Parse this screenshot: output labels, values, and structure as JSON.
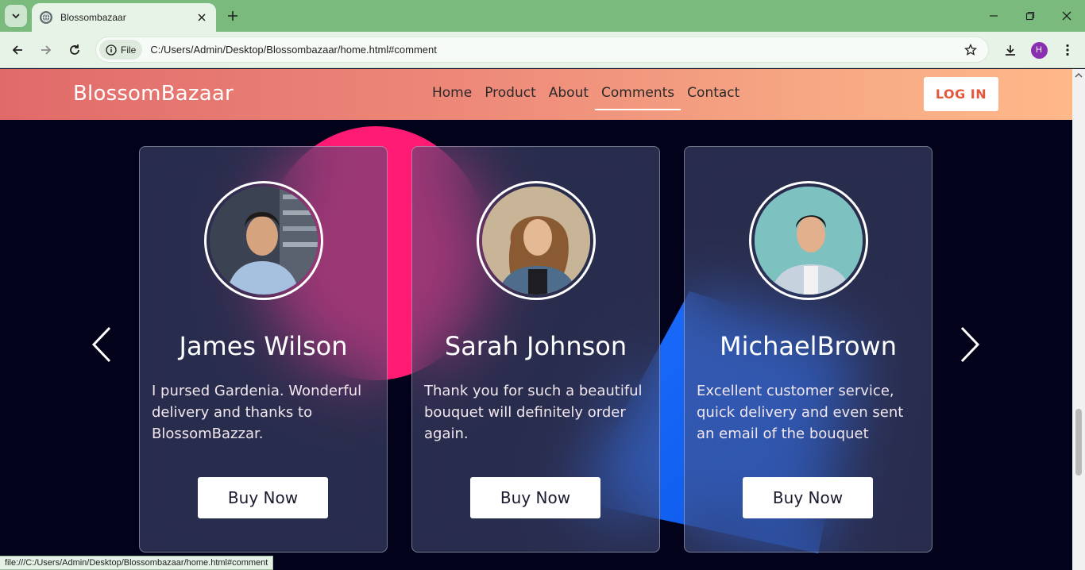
{
  "browser": {
    "tab_title": "Blossombazaar",
    "site_info_label": "File",
    "url": "C:/Users/Admin/Desktop/Blossombazaar/home.html#comment",
    "profile_initial": "H",
    "status_url": "file:///C:/Users/Admin/Desktop/Blossombazaar/home.html#comment",
    "colors": {
      "tabbar": "#7bba7d",
      "toolbar": "#e8f3e8",
      "profile": "#8a2fb0"
    }
  },
  "site": {
    "brand": "BlossomBazaar",
    "nav": [
      {
        "label": "Home",
        "active": false
      },
      {
        "label": "Product",
        "active": false
      },
      {
        "label": "About",
        "active": false
      },
      {
        "label": "Comments",
        "active": true
      },
      {
        "label": "Contact",
        "active": false
      }
    ],
    "login_label": "LOG IN",
    "colors": {
      "header_start": "#e06a6a",
      "header_end": "#ffb889",
      "login_text": "#e4573a",
      "background": "#02031a"
    }
  },
  "testimonials": {
    "prev_icon": "chevron-left-icon",
    "next_icon": "chevron-right-icon",
    "cards": [
      {
        "name": "James Wilson",
        "comment": "I pursed Gardenia. Wonderful delivery and thanks to BlossomBazzar.",
        "button": "Buy Now"
      },
      {
        "name": "Sarah Johnson",
        "comment": "Thank you for such a beautiful bouquet will definitely order again.",
        "button": "Buy Now"
      },
      {
        "name": "MichaelBrown",
        "comment": "Excellent customer service, quick delivery and even sent an email of the bouquet",
        "button": "Buy Now"
      }
    ]
  }
}
